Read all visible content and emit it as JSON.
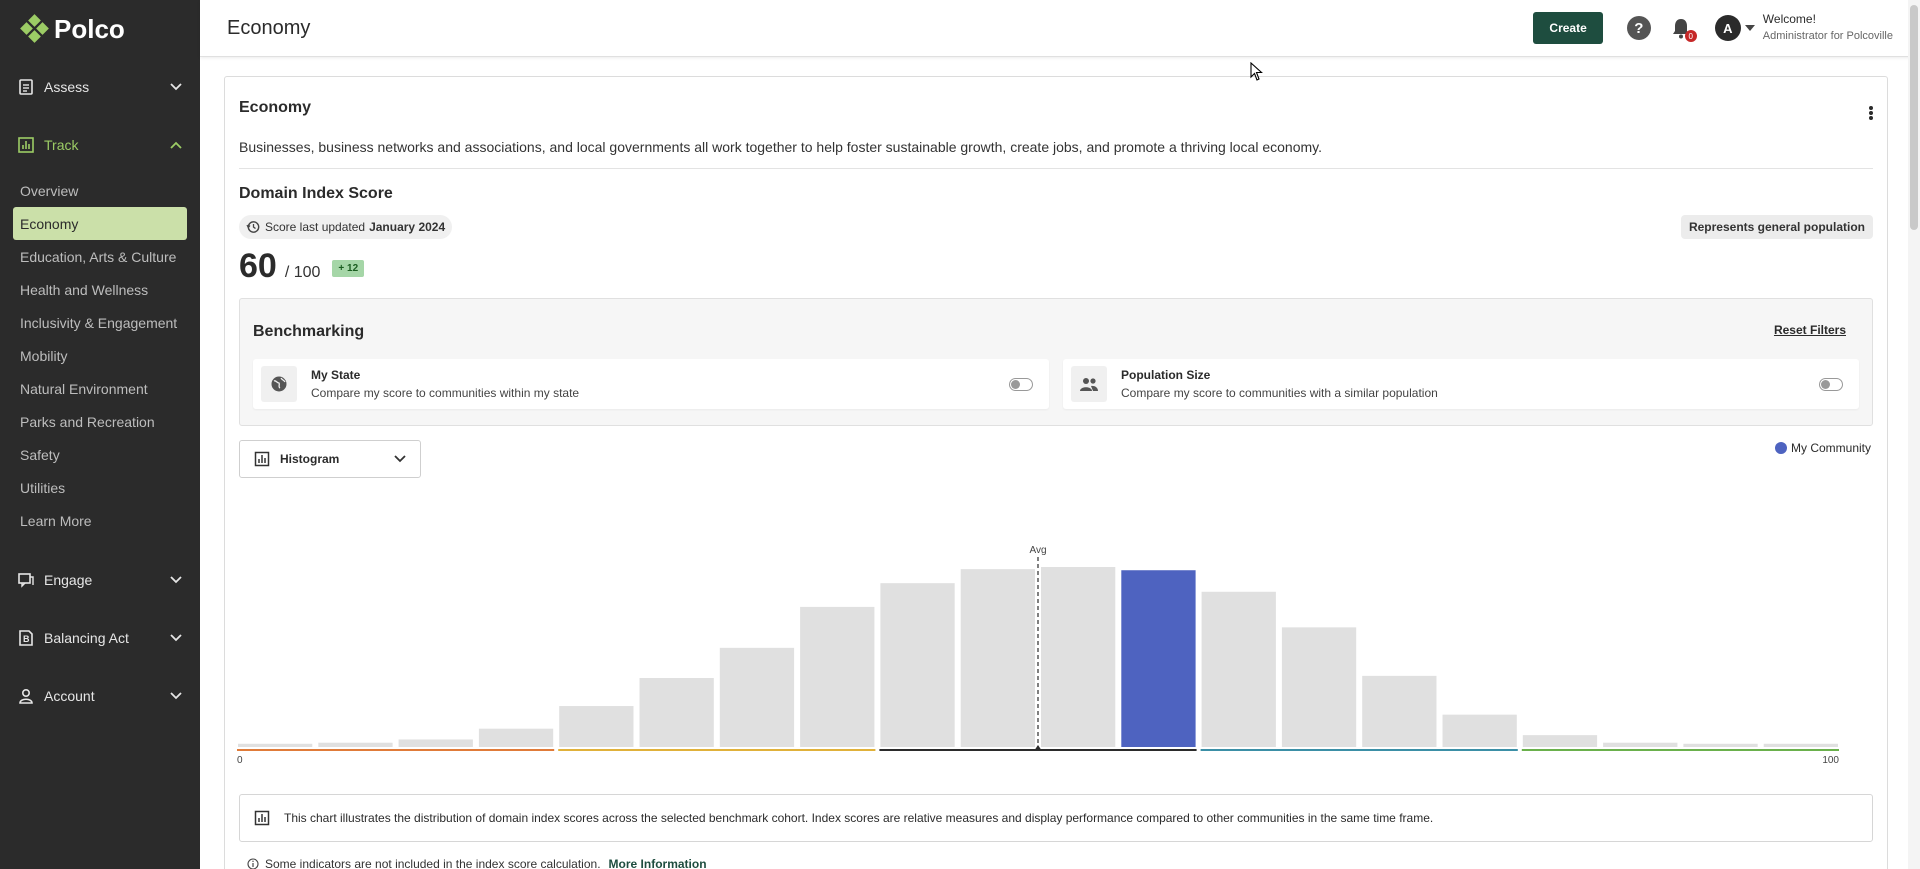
{
  "brand": {
    "name": "Polco"
  },
  "sidebar": {
    "groups": [
      {
        "label": "Assess",
        "icon": "clipboard-icon",
        "open": false
      },
      {
        "label": "Track",
        "icon": "bar-chart-icon",
        "open": true
      },
      {
        "label": "Engage",
        "icon": "chat-icon",
        "open": false
      },
      {
        "label": "Balancing Act",
        "icon": "balancing-act-icon",
        "open": false
      },
      {
        "label": "Account",
        "icon": "person-icon",
        "open": false
      }
    ],
    "track_items": [
      {
        "label": "Overview"
      },
      {
        "label": "Economy",
        "active": true
      },
      {
        "label": "Education, Arts & Culture"
      },
      {
        "label": "Health and Wellness"
      },
      {
        "label": "Inclusivity & Engagement"
      },
      {
        "label": "Mobility"
      },
      {
        "label": "Natural Environment"
      },
      {
        "label": "Parks and Recreation"
      },
      {
        "label": "Safety"
      },
      {
        "label": "Utilities"
      },
      {
        "label": "Learn More"
      }
    ]
  },
  "header": {
    "title": "Economy",
    "create_label": "Create",
    "help_label": "?",
    "notification_count": "0",
    "avatar_initial": "A",
    "welcome": "Welcome!",
    "role": "Administrator for Polcoville"
  },
  "card": {
    "title": "Economy",
    "description": "Businesses, business networks and associations, and local governments all work together to help foster sustainable growth, create jobs, and promote a thriving local economy.",
    "score_section_title": "Domain Index Score",
    "updated_prefix": "Score last updated",
    "updated_date": "January 2024",
    "population_badge": "Represents general population",
    "score": "60",
    "score_max": "/ 100",
    "score_delta": "+ 12"
  },
  "benchmarking": {
    "title": "Benchmarking",
    "reset_label": "Reset Filters",
    "filters": [
      {
        "title": "My State",
        "subtitle": "Compare my score to communities within my state",
        "icon": "globe-icon",
        "enabled": false
      },
      {
        "title": "Population Size",
        "subtitle": "Compare my score to communities with a similar population",
        "icon": "people-icon",
        "enabled": false
      }
    ]
  },
  "chart_view": {
    "selected": "Histogram",
    "legend_label": "My Community",
    "legend_color": "#4e63c0"
  },
  "chart_data": {
    "type": "bar",
    "title": "",
    "xlabel": "",
    "ylabel": "",
    "x_range": [
      0,
      100
    ],
    "x_tick_labels": [
      "0",
      "100"
    ],
    "bin_count": 20,
    "values": [
      3,
      4,
      7,
      17,
      38,
      64,
      92,
      130,
      152,
      165,
      167,
      164,
      144,
      111,
      66,
      30,
      11,
      4,
      3,
      3
    ],
    "highlight_bin": 11,
    "avg_label": "Avg",
    "avg_x": 50,
    "bar_color": "#e0e0e0",
    "highlight_color": "#4e63c0",
    "band_colors": [
      "#e07b39",
      "#e0b13a",
      "#2b2b2b",
      "#3b8fa6",
      "#6ab04c"
    ],
    "grid": false
  },
  "info": {
    "chart_note": "This chart illustrates the distribution of domain index scores across the selected benchmark cohort. Index scores are relative measures and display performance compared to other communities in the same time frame.",
    "indicators_note": "Some indicators are not included in the index score calculation.",
    "more_info_label": "More Information"
  }
}
